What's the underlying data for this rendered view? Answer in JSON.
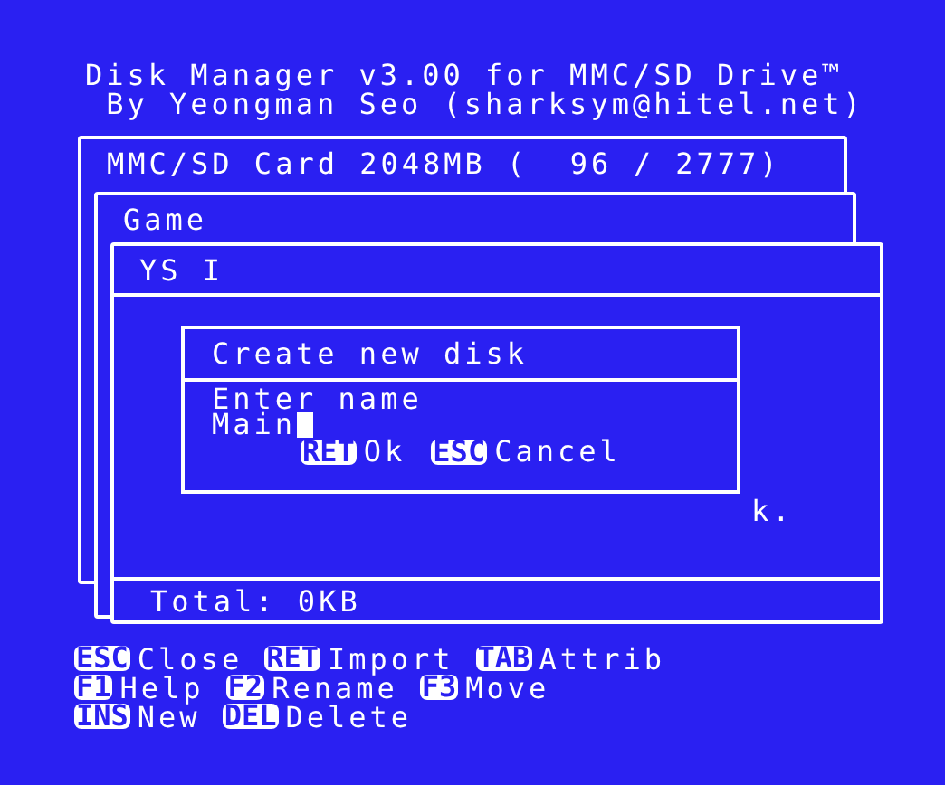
{
  "header": {
    "title": "Disk Manager v3.00 for MMC/SD Drive™",
    "subtitle": " By Yeongman Seo (sharksym@hitel.net)"
  },
  "windows": [
    {
      "title": "MMC/SD Card 2048MB (  96 / 2777)"
    },
    {
      "title": "Game"
    },
    {
      "title": "YS I",
      "fragment": "k.",
      "footer": "Total: 0KB"
    }
  ],
  "dialog": {
    "title": "Create new disk",
    "prompt": "Enter name",
    "value": "Main",
    "buttons": [
      {
        "key": "RET",
        "label": "Ok"
      },
      {
        "key": "ESC",
        "label": "Cancel"
      }
    ]
  },
  "key_help": [
    [
      {
        "key": "ESC",
        "label": "Close"
      },
      {
        "key": "RET",
        "label": "Import"
      },
      {
        "key": "TAB",
        "label": "Attrib"
      }
    ],
    [
      {
        "key": "F1",
        "label": "Help"
      },
      {
        "key": "F2",
        "label": "Rename"
      },
      {
        "key": "F3",
        "label": "Move"
      }
    ],
    [
      {
        "key": "INS",
        "label": "New"
      },
      {
        "key": "DEL",
        "label": "Delete"
      }
    ]
  ]
}
